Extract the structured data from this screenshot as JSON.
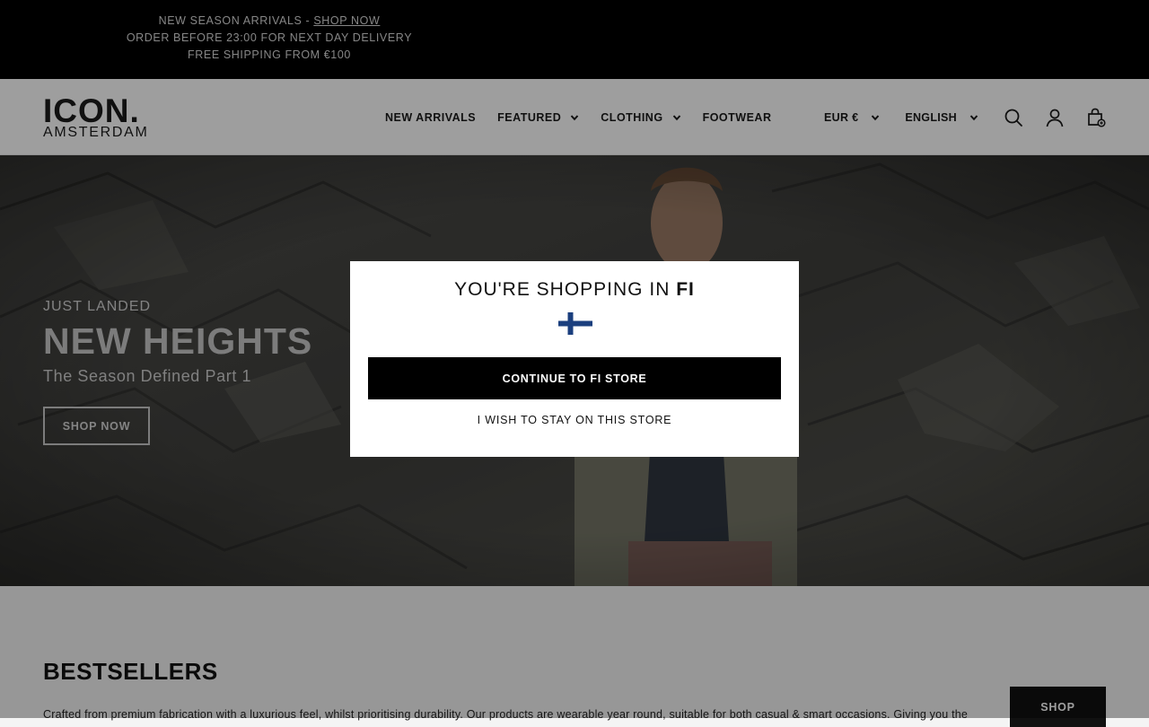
{
  "announcement": {
    "line1_prefix": "NEW SEASON ARRIVALS - ",
    "line1_link": "SHOP NOW",
    "line2": "ORDER BEFORE 23:00 FOR NEXT DAY DELIVERY",
    "line3": "FREE SHIPPING FROM €100"
  },
  "header": {
    "logo_word": "ICON.",
    "logo_sub": "AMSTERDAM",
    "nav": [
      {
        "label": "NEW ARRIVALS",
        "has_dropdown": false
      },
      {
        "label": "FEATURED",
        "has_dropdown": true
      },
      {
        "label": "CLOTHING",
        "has_dropdown": true
      },
      {
        "label": "FOOTWEAR",
        "has_dropdown": false
      }
    ],
    "currency": "EUR €",
    "language": "ENGLISH",
    "icons": [
      "search-icon",
      "account-icon",
      "cart-icon"
    ]
  },
  "hero": {
    "kicker": "JUST LANDED",
    "title": "NEW HEIGHTS",
    "subtitle": "The Season Defined Part 1",
    "button": "SHOP NOW"
  },
  "modal": {
    "title_prefix": "YOU'RE SHOPPING IN ",
    "title_country": "FI",
    "flag": "finland-flag-icon",
    "primary_button": "CONTINUE TO FI STORE",
    "secondary_link": "I WISH TO STAY ON THIS STORE"
  },
  "bestsellers": {
    "title": "BESTSELLERS",
    "description": "Crafted from premium fabrication with a luxurious feel, whilst prioritising durability. Our products are wearable year round, suitable for both casual & smart occasions. Giving you the",
    "button": "SHOP"
  },
  "colors": {
    "announcement_bg": "#000000",
    "primary_button_bg": "#000000",
    "flag_blue": "#1b3f7e"
  }
}
